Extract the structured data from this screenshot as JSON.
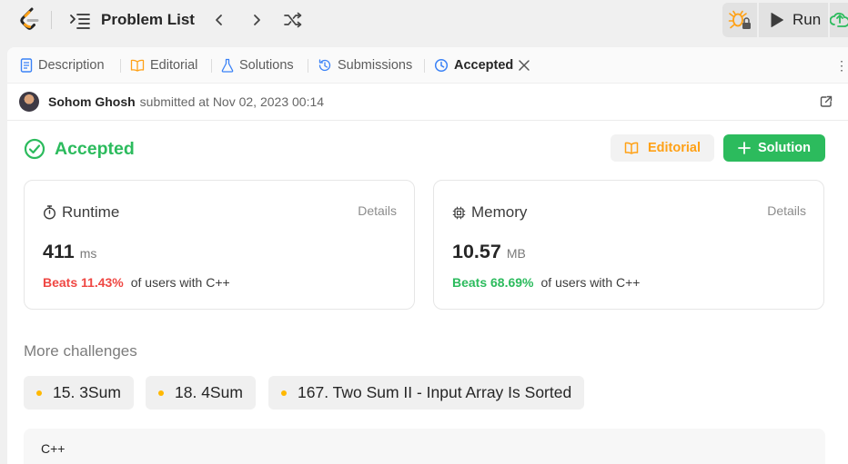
{
  "topbar": {
    "problem_list_label": "Problem List",
    "run_label": "Run"
  },
  "tabs": [
    {
      "label": "Description",
      "icon": "document-icon"
    },
    {
      "label": "Editorial",
      "icon": "book-icon"
    },
    {
      "label": "Solutions",
      "icon": "flask-icon"
    },
    {
      "label": "Submissions",
      "icon": "history-icon"
    },
    {
      "label": "Accepted",
      "icon": "clock-icon"
    }
  ],
  "submission": {
    "user": "Sohom Ghosh",
    "submitted_text": "submitted at Nov 02, 2023 00:14"
  },
  "result": {
    "status": "Accepted",
    "editorial_label": "Editorial",
    "solution_label": "Solution"
  },
  "runtime": {
    "title": "Runtime",
    "details_label": "Details",
    "value": "411",
    "unit": "ms",
    "beats": "Beats 11.43%",
    "suffix": "of users with C++"
  },
  "memory": {
    "title": "Memory",
    "details_label": "Details",
    "value": "10.57",
    "unit": "MB",
    "beats": "Beats 68.69%",
    "suffix": "of users with C++"
  },
  "more_challenges": {
    "title": "More challenges",
    "items": [
      "15. 3Sum",
      "18. 4Sum",
      "167. Two Sum II - Input Array Is Sorted"
    ]
  },
  "code": {
    "language": "C++"
  },
  "colors": {
    "accent_green": "#2cbb5d",
    "accent_orange": "#ffa116",
    "beats_red": "#ef4743",
    "chip_dot": "#ffb800"
  }
}
